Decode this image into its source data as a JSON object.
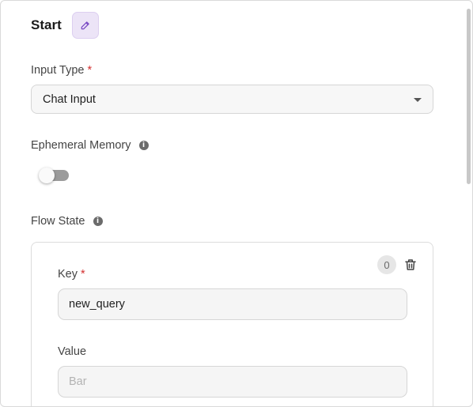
{
  "header": {
    "title": "Start"
  },
  "input_type": {
    "label": "Input Type",
    "required_mark": "*",
    "selected": "Chat Input"
  },
  "ephemeral_memory": {
    "label": "Ephemeral Memory",
    "info_glyph": "i",
    "enabled": false
  },
  "flow_state": {
    "label": "Flow State",
    "info_glyph": "i",
    "items": [
      {
        "index": "0",
        "key_label": "Key",
        "key_required_mark": "*",
        "key_value": "new_query",
        "value_label": "Value",
        "value_placeholder": "Bar",
        "value_value": ""
      }
    ]
  },
  "icons": {
    "edit": "pencil-icon",
    "dropdown": "chevron-down-icon",
    "info": "info-icon",
    "delete": "trash-icon"
  },
  "colors": {
    "accent_bg": "#ece4f7",
    "accent_icon": "#7b4bc4",
    "required": "#d32f2f"
  }
}
